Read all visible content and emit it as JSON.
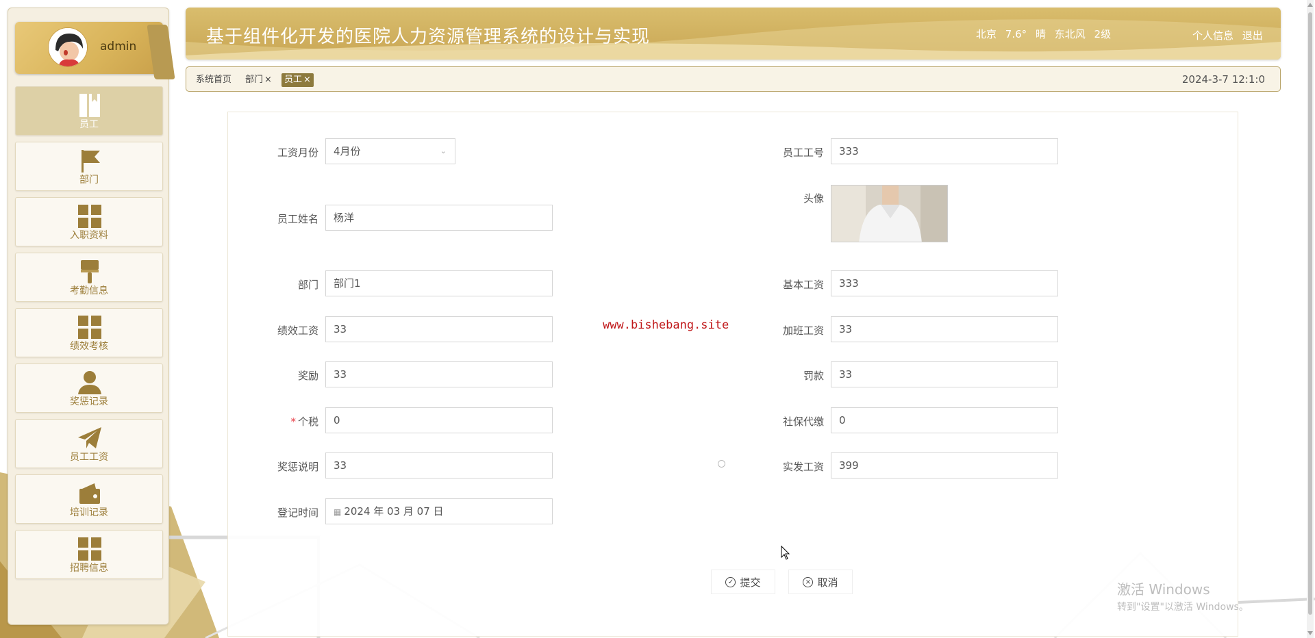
{
  "user": {
    "name": "admin"
  },
  "sidebar": {
    "items": [
      {
        "label": "员工",
        "icon": "book-icon",
        "active": true
      },
      {
        "label": "部门",
        "icon": "flag-icon"
      },
      {
        "label": "入职资料",
        "icon": "grid-icon"
      },
      {
        "label": "考勤信息",
        "icon": "brush-icon"
      },
      {
        "label": "绩效考核",
        "icon": "grid-icon"
      },
      {
        "label": "奖惩记录",
        "icon": "user-icon"
      },
      {
        "label": "员工工资",
        "icon": "paper-plane-icon"
      },
      {
        "label": "培训记录",
        "icon": "wallet-icon"
      },
      {
        "label": "招聘信息",
        "icon": "grid-icon"
      }
    ]
  },
  "header": {
    "title": "基于组件化开发的医院人力资源管理系统的设计与实现",
    "weather": {
      "city": "北京",
      "temp": "7.6°",
      "condition": "晴",
      "wind": "东北风",
      "level": "2级"
    },
    "links": {
      "profile": "个人信息",
      "logout": "退出"
    }
  },
  "tabs": {
    "home": "系统首页",
    "items": [
      {
        "label": "部门",
        "close": "×"
      },
      {
        "label": "员工",
        "close": "×",
        "active": true
      }
    ],
    "datetime": "2024-3-7 12:1:0"
  },
  "form": {
    "salary_month": {
      "label": "工资月份",
      "value": "4月份"
    },
    "employee_no": {
      "label": "员工工号",
      "value": "333"
    },
    "employee_name": {
      "label": "员工姓名",
      "value": "杨洋"
    },
    "avatar": {
      "label": "头像"
    },
    "department": {
      "label": "部门",
      "value": "部门1"
    },
    "base_salary": {
      "label": "基本工资",
      "value": "333"
    },
    "performance_salary": {
      "label": "绩效工资",
      "value": "33"
    },
    "overtime_salary": {
      "label": "加班工资",
      "value": "33"
    },
    "bonus": {
      "label": "奖励",
      "value": "33"
    },
    "penalty": {
      "label": "罚款",
      "value": "33"
    },
    "tax": {
      "label": "个税",
      "required_mark": "*",
      "value": "0"
    },
    "social_security": {
      "label": "社保代缴",
      "value": "0"
    },
    "reward_note": {
      "label": "奖惩说明",
      "value": "33"
    },
    "net_salary": {
      "label": "实发工资",
      "value": "399"
    },
    "register_time": {
      "label": "登记时间",
      "value": "2024 年 03 月 07 日"
    },
    "submit_label": "提交",
    "cancel_label": "取消"
  },
  "watermark": "www.bishebang.site",
  "windows_activation": {
    "title": "激活 Windows",
    "subtitle": "转到\"设置\"以激活 Windows。"
  },
  "colors": {
    "gold": "#c9a654",
    "nav_text": "#9c7e3a",
    "active_tab": "#8d7a3d",
    "required": "#e8434c",
    "watermark": "#c0181a"
  }
}
